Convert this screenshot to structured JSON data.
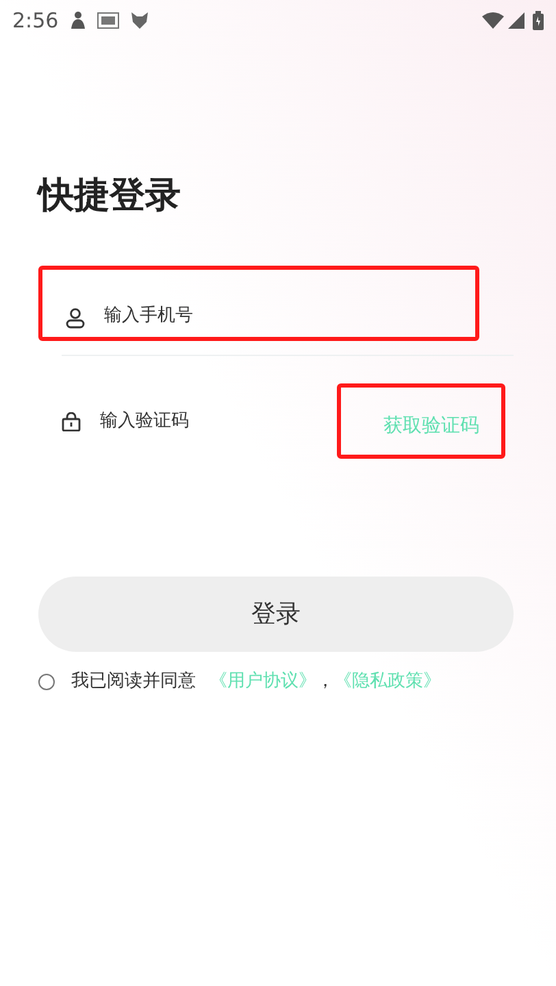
{
  "status_bar": {
    "time": "2:56"
  },
  "title": "快捷登录",
  "phone_field": {
    "placeholder": "输入手机号",
    "highlighted": true
  },
  "code_field": {
    "placeholder": "输入验证码"
  },
  "get_code_button": {
    "label": "获取验证码",
    "highlighted": true
  },
  "login_button": {
    "label": "登录"
  },
  "agreement": {
    "checked": false,
    "text": "我已阅读并同意",
    "links": [
      "《用户协议》",
      "《隐私政策》"
    ],
    "separator": "，"
  }
}
